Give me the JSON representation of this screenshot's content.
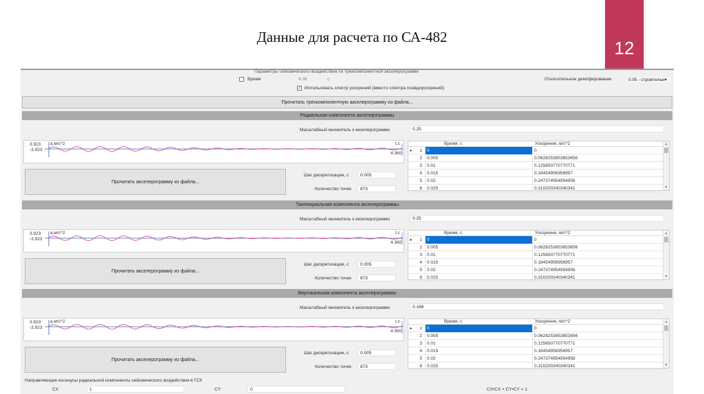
{
  "slide": {
    "title": "Данные для расчета по СА-482",
    "page_number": "12"
  },
  "app": {
    "params_header": "Параметры сейсмического воздействия по трехкомпонентной акселерограмме",
    "time_label": "Время",
    "time_value": "4.36",
    "time_unit": "с",
    "use_spectrum_label": "Использовать спектр ускорений (вместо спектра псевдоускорений)",
    "damping_label": "Относительное демпфирование",
    "damping_value": "0.05 - строительн▾",
    "read_three_button": "Прочитать трехкомпонентную акселерограмму из файла...",
    "components": [
      {
        "header": "Радиальная компонента акселерограммы",
        "scale_label": "Масштабный множитель к акселерограмме",
        "scale_value": "0.25",
        "ymax": "3.923",
        "ymin": "-3.923",
        "yaxis_label": "a,м/с^2",
        "xaxis_label": "t,с",
        "xmax": "4.360",
        "read_button": "Прочитать акселерограмму из файла...",
        "step_label": "Шаг дискретизации, с",
        "step_value": "0.005",
        "points_label": "Количество точек",
        "points_value": "873"
      },
      {
        "header": "Тангенциальная компонента акселерограммы",
        "scale_label": "Масштабный множитель к акселерограмме",
        "scale_value": "0.25",
        "ymax": "3.923",
        "ymin": "-3.923",
        "yaxis_label": "a,м/с^2",
        "xaxis_label": "t,с",
        "xmax": "4.360",
        "read_button": "Прочитать акселерограмму из файла...",
        "step_label": "Шаг дискретизации, с",
        "step_value": "0.005",
        "points_label": "Количество точек",
        "points_value": "873"
      },
      {
        "header": "Вертикальная компонента акселерограммы",
        "scale_label": "Масштабный множитель к акселерограмме",
        "scale_value": "0.168",
        "ymax": "3.923",
        "ymin": "-3.923",
        "yaxis_label": "a,м/с^2",
        "xaxis_label": "t,с",
        "xmax": "4.360",
        "read_button": "Прочитать акселерограмму из файла...",
        "step_label": "Шаг дискретизации, с",
        "step_value": "0.005",
        "points_label": "Количество точек",
        "points_value": "873"
      }
    ],
    "table": {
      "col_time": "Время, с",
      "col_accel": "Ускорение, м/с^2",
      "rows": [
        {
          "n": "1",
          "t": "0",
          "a": "0"
        },
        {
          "n": "2",
          "t": "0.005",
          "a": "0.0628253853853856"
        },
        {
          "n": "3",
          "t": "0.01",
          "a": "0.125650770770771"
        },
        {
          "n": "4",
          "t": "0.015",
          "a": "0.18454956956957"
        },
        {
          "n": "5",
          "t": "0.02",
          "a": "0.247374954954956"
        },
        {
          "n": "6",
          "t": "0.025",
          "a": "0.310200340340341"
        }
      ]
    },
    "cosines_label": "Направляющие косинусы радиальной компоненты сейсмического воздействия в ГСК",
    "cx_label": "CX",
    "cx_value": "1",
    "cy_label": "CY",
    "cy_value": "0",
    "sum_label": "CX•CX + CY•CY = 1",
    "colors": {
      "selection": "#0a6fd6",
      "signal_pink": "#d23c8c",
      "signal_blue": "#3c5ab4",
      "badge": "#c0395a"
    }
  }
}
